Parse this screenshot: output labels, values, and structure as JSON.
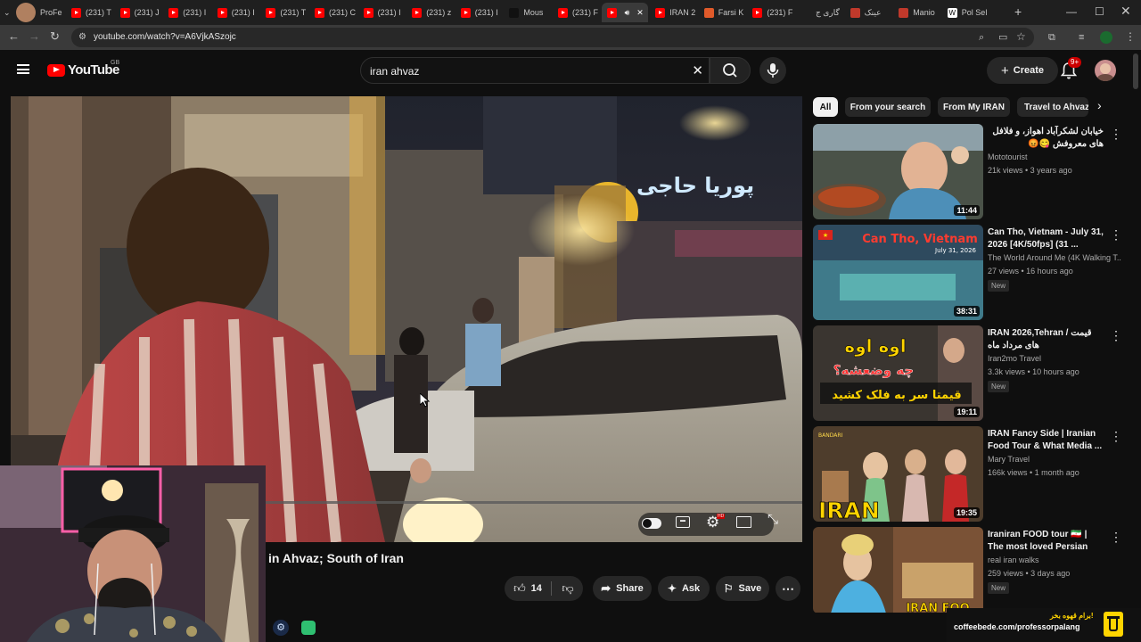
{
  "browser": {
    "tabs": [
      {
        "label": "ProFe",
        "kind": "avatar"
      },
      {
        "label": "(231) T",
        "kind": "yt"
      },
      {
        "label": "(231) J",
        "kind": "yt"
      },
      {
        "label": "(231) I",
        "kind": "yt"
      },
      {
        "label": "(231) I",
        "kind": "yt"
      },
      {
        "label": "(231) T",
        "kind": "yt"
      },
      {
        "label": "(231) C",
        "kind": "yt"
      },
      {
        "label": "(231) I",
        "kind": "yt"
      },
      {
        "label": "(231) z",
        "kind": "yt"
      },
      {
        "label": "(231) I",
        "kind": "yt"
      },
      {
        "label": "Mous",
        "kind": "dark"
      },
      {
        "label": "(231) F",
        "kind": "yt"
      },
      {
        "label": "",
        "kind": "yt-active"
      },
      {
        "label": "IRAN 2",
        "kind": "yt"
      },
      {
        "label": "Farsi K",
        "kind": "orange"
      },
      {
        "label": "(231) F",
        "kind": "yt"
      },
      {
        "label": "گاری ج",
        "kind": "none"
      },
      {
        "label": "عینک",
        "kind": "red"
      },
      {
        "label": "Manio",
        "kind": "red"
      },
      {
        "label": "Pol Sel",
        "kind": "w"
      }
    ],
    "url": "youtube.com/watch?v=A6VjkASzojc",
    "new_tab_icon": "plus-icon"
  },
  "youtube": {
    "logo_text": "YouTube",
    "region": "GB",
    "search_value": "iran ahvaz",
    "create_label": "Create",
    "notification_count": "9+"
  },
  "video": {
    "title": "in Ahvaz; South of Iran",
    "like_count": "14",
    "share_label": "Share",
    "ask_label": "Ask",
    "save_label": "Save",
    "sign_text": "پوریا حاجی"
  },
  "chips": [
    "All",
    "From your search",
    "From My IRAN",
    "Travel to Ahvaz"
  ],
  "recommendations": [
    {
      "title": "خیابان لشکرآباد اهواز، و فلافل های معروفش 😋😡",
      "channel": "Mototourist",
      "meta": "21k views • 3 years ago",
      "duration": "11:44",
      "badge": ""
    },
    {
      "title": "Can Tho, Vietnam - July 31, 2026 [4K/50fps] (31 ...",
      "channel": "The World Around Me (4K Walking T...",
      "meta": "27 views • 16 hours ago",
      "duration": "38:31",
      "badge": "New",
      "thumb_text": "Can Tho, Vietnam",
      "thumb_sub": "July 31, 2026"
    },
    {
      "title": "IRAN 2026,Tehran / قیمت های مرداد ماه",
      "channel": "Iran2mo Travel",
      "meta": "3.3k views • 10 hours ago",
      "duration": "19:11",
      "badge": "New",
      "thumb_text": "اوه اوه",
      "thumb_text2": "چه وضعشه؟",
      "thumb_text3": "قیمتا سر به فلک کشید"
    },
    {
      "title": "IRAN Fancy Side | Iranian Food Tour & What Media ...",
      "channel": "Mary Travel",
      "meta": "166k views • 1 month ago",
      "duration": "19:35",
      "badge": "",
      "thumb_text": "IRAN",
      "thumb_sub": "BANDARI"
    },
    {
      "title": "Iraniran FOOD tour 🇮🇷 | The most loved Persian foods ...",
      "channel": "real iran walks",
      "meta": "259 views • 3 days ago",
      "duration": "",
      "badge": "New",
      "thumb_text": "IRAN FOO"
    }
  ],
  "overlay": {
    "coffee_text": "برام قهوه بخر!",
    "coffee_url": "coffeebede.com/professorpalang"
  }
}
